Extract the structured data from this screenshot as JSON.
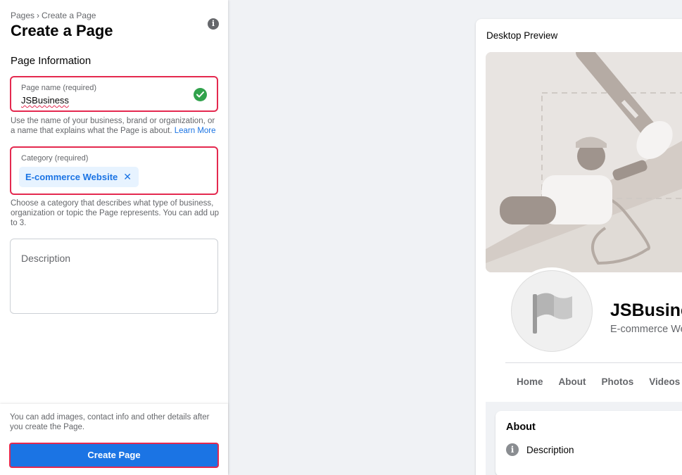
{
  "breadcrumb": {
    "parent": "Pages",
    "separator": "›",
    "current": "Create a Page"
  },
  "header": {
    "title": "Create a Page",
    "info_icon": "i"
  },
  "form": {
    "section_title": "Page Information",
    "page_name": {
      "label": "Page name (required)",
      "value": "JSBusiness",
      "help": "Use the name of your business, brand or organization, or a name that explains what the Page is about.",
      "learn_more": "Learn More"
    },
    "category": {
      "label": "Category (required)",
      "chip": "E-commerce Website",
      "chip_remove": "✕",
      "help": "Choose a category that describes what type of business, organization or topic the Page represents. You can add up to 3."
    },
    "description": {
      "placeholder": "Description"
    }
  },
  "footer": {
    "text": "You can add images, contact info and other details after you create the Page.",
    "create_button": "Create Page"
  },
  "preview": {
    "title": "Desktop Preview",
    "page_name": "JSBusiness",
    "page_category": "E-commerce Website",
    "tabs": [
      "Home",
      "About",
      "Photos",
      "Videos"
    ],
    "about_title": "About",
    "about_description": "Description",
    "about_icon": "i"
  },
  "colors": {
    "accent": "#1b74e4",
    "error_border": "#e4294f",
    "success": "#31a24c"
  }
}
